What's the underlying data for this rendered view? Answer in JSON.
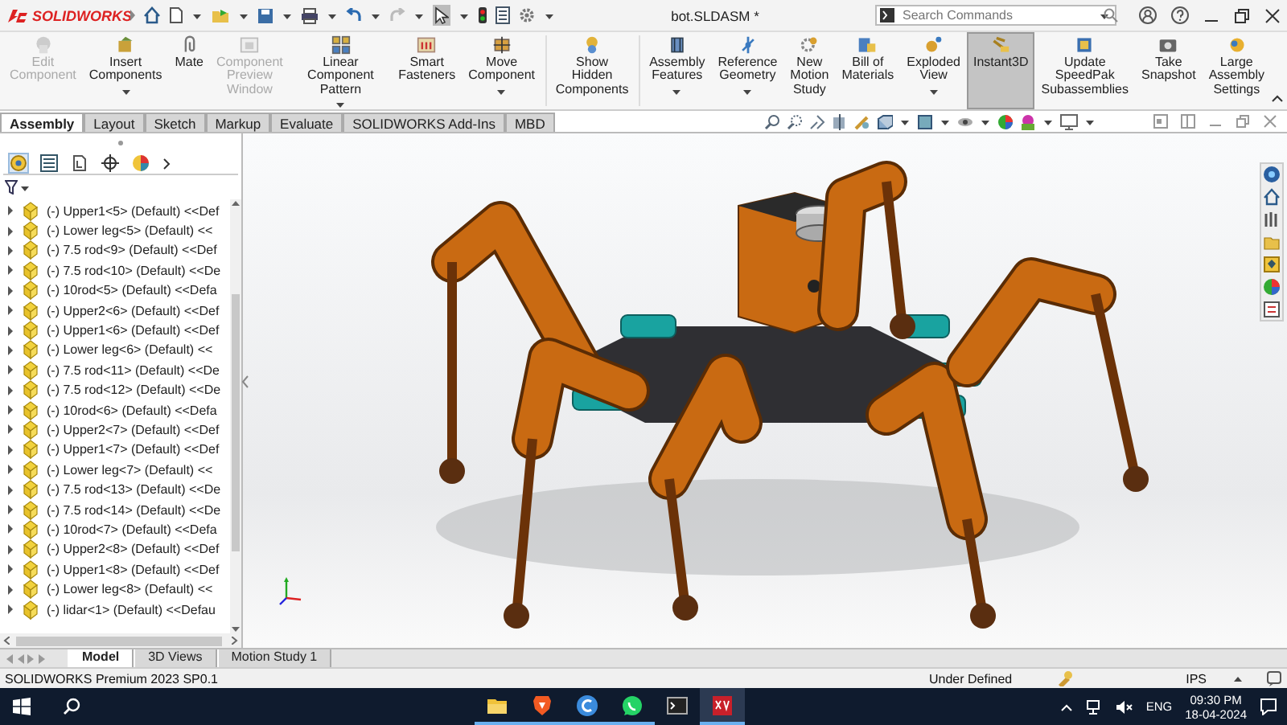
{
  "app": {
    "logo": "SOLIDWORKS",
    "title": "bot.SLDASM *",
    "search": {
      "placeholder": "Search Commands"
    }
  },
  "ribbon": [
    {
      "label": "Edit\nComponent",
      "disabled": true,
      "dropdown": false,
      "selected": false
    },
    {
      "label": "Insert\nComponents",
      "disabled": false,
      "dropdown": true,
      "selected": false
    },
    {
      "label": "Mate",
      "disabled": false,
      "dropdown": false,
      "selected": false
    },
    {
      "label": "Component\nPreview\nWindow",
      "disabled": true,
      "dropdown": false,
      "selected": false
    },
    {
      "label": "Linear Component\nPattern",
      "disabled": false,
      "dropdown": true,
      "selected": false
    },
    {
      "label": "Smart\nFasteners",
      "disabled": false,
      "dropdown": false,
      "selected": false
    },
    {
      "label": "Move\nComponent",
      "disabled": false,
      "dropdown": true,
      "selected": false
    },
    {
      "label": "Show\nHidden\nComponents",
      "disabled": false,
      "dropdown": false,
      "selected": false
    },
    {
      "label": "Assembly\nFeatures",
      "disabled": false,
      "dropdown": true,
      "selected": false
    },
    {
      "label": "Reference\nGeometry",
      "disabled": false,
      "dropdown": true,
      "selected": false
    },
    {
      "label": "New\nMotion\nStudy",
      "disabled": false,
      "dropdown": false,
      "selected": false
    },
    {
      "label": "Bill of\nMaterials",
      "disabled": false,
      "dropdown": false,
      "selected": false
    },
    {
      "label": "Exploded\nView",
      "disabled": false,
      "dropdown": true,
      "selected": false
    },
    {
      "label": "Instant3D",
      "disabled": false,
      "dropdown": false,
      "selected": true
    },
    {
      "label": "Update\nSpeedPak\nSubassemblies",
      "disabled": false,
      "dropdown": false,
      "selected": false
    },
    {
      "label": "Take\nSnapshot",
      "disabled": false,
      "dropdown": false,
      "selected": false
    },
    {
      "label": "Large\nAssembly\nSettings",
      "disabled": false,
      "dropdown": false,
      "selected": false
    }
  ],
  "command_tabs": [
    {
      "label": "Assembly",
      "selected": true
    },
    {
      "label": "Layout",
      "selected": false
    },
    {
      "label": "Sketch",
      "selected": false
    },
    {
      "label": "Markup",
      "selected": false
    },
    {
      "label": "Evaluate",
      "selected": false
    },
    {
      "label": "SOLIDWORKS Add-Ins",
      "selected": false
    },
    {
      "label": "MBD",
      "selected": false
    }
  ],
  "tree": [
    {
      "label": "(-) Upper1<5> (Default) <<Def",
      "expanded": false
    },
    {
      "label": "(-) Lower leg<5> (Default) <<",
      "expanded": false
    },
    {
      "label": "(-) 7.5 rod<9> (Default) <<Def",
      "expanded": false
    },
    {
      "label": "(-) 7.5 rod<10> (Default) <<De",
      "expanded": false
    },
    {
      "label": "(-) 10rod<5> (Default) <<Defa",
      "expanded": false
    },
    {
      "label": "(-) Upper2<6> (Default) <<Def",
      "expanded": false
    },
    {
      "label": "(-) Upper1<6> (Default) <<Def",
      "expanded": false
    },
    {
      "label": "(-) Lower leg<6> (Default) <<",
      "expanded": false
    },
    {
      "label": "(-) 7.5 rod<11> (Default) <<De",
      "expanded": false
    },
    {
      "label": "(-) 7.5 rod<12> (Default) <<De",
      "expanded": false
    },
    {
      "label": "(-) 10rod<6> (Default) <<Defa",
      "expanded": false
    },
    {
      "label": "(-) Upper2<7> (Default) <<Def",
      "expanded": false
    },
    {
      "label": "(-) Upper1<7> (Default) <<Def",
      "expanded": false
    },
    {
      "label": "(-) Lower leg<7> (Default) <<",
      "expanded": false
    },
    {
      "label": "(-) 7.5 rod<13> (Default) <<De",
      "expanded": false
    },
    {
      "label": "(-) 7.5 rod<14> (Default) <<De",
      "expanded": false
    },
    {
      "label": "(-) 10rod<7> (Default) <<Defa",
      "expanded": false
    },
    {
      "label": "(-) Upper2<8> (Default) <<Def",
      "expanded": false
    },
    {
      "label": "(-) Upper1<8> (Default) <<Def",
      "expanded": false
    },
    {
      "label": "(-) Lower leg<8> (Default) <<",
      "expanded": false
    },
    {
      "label": "(-) lidar<1> (Default) <<Defau",
      "expanded": false
    }
  ],
  "bottom_tabs": [
    {
      "label": "Model",
      "selected": true
    },
    {
      "label": "3D Views",
      "selected": false
    },
    {
      "label": "Motion Study 1",
      "selected": false
    }
  ],
  "status_bar": {
    "product": "SOLIDWORKS Premium 2023 SP0.1",
    "state": "Under Defined",
    "units": "IPS"
  },
  "taskbar": {
    "language": "ENG",
    "time": "09:30 PM",
    "date": "18-04-2024"
  }
}
